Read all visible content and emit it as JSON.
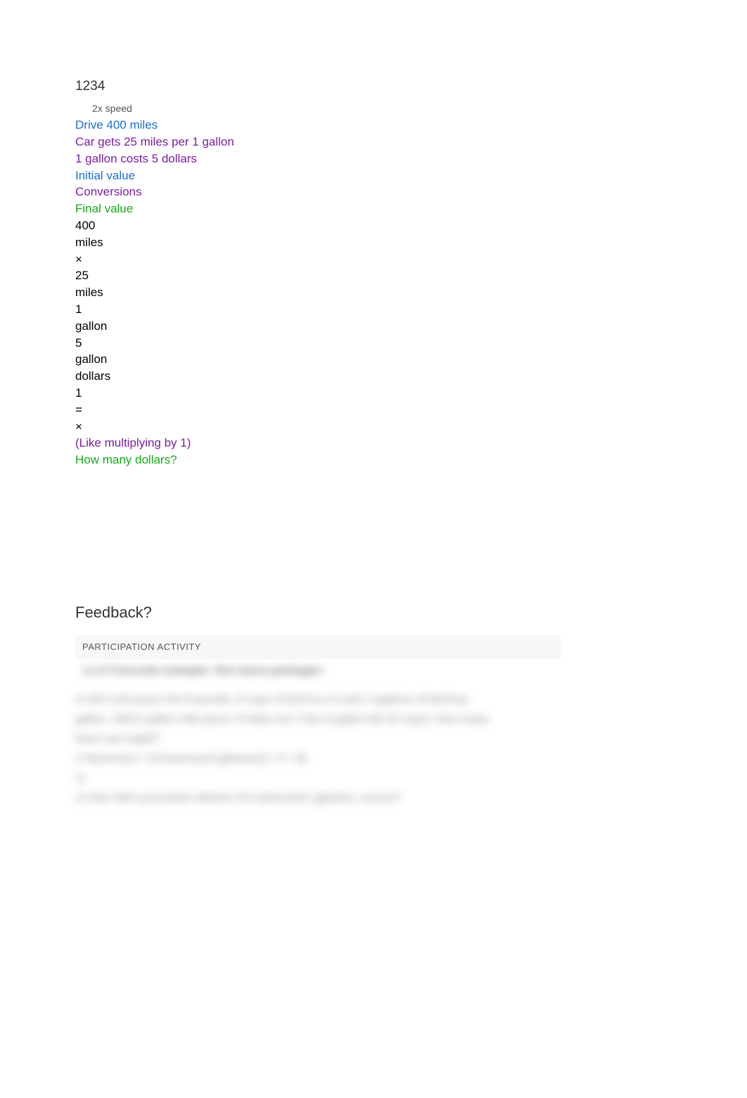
{
  "header": {
    "numbers": "1234",
    "speed": "2x speed"
  },
  "problem": {
    "line1": "Drive 400 miles",
    "line2": "Car gets 25 miles per 1 gallon",
    "line3": "1 gallon costs 5 dollars",
    "label_initial": "Initial value",
    "label_conversions": "Conversions",
    "label_final": "Final value"
  },
  "work": {
    "l1": "400",
    "l2": "miles",
    "l3": "×",
    "l4": "25",
    "l5": "miles",
    "l6": "1",
    "l7": "gallon",
    "l8": "5",
    "l9": "gallon",
    "l10": "dollars",
    "l11": "1",
    "l12": "=",
    "l13": "×",
    "note": "(Like multiplying by 1)",
    "question": "How many dollars?"
  },
  "feedback": {
    "label": "Feedback?"
  },
  "activity": {
    "header": "PARTICIPATION ACTIVITY",
    "blurred_title": "1.1.5 Concrete example: Hot sauce packages",
    "blurred_p1": "A chili cook pours the 8 pounds, 8 cups of beef to a 5 and, 3 gallons of ketchup",
    "blurred_p2": "gallon, 10612 gallon milk pours 3 Pablo not 1 Nov 8 gallon bill 16 cups). How many",
    "blurred_p3": "how's are might?",
    "blurred_p4": "1 Nummusic × [3 teamound (glasses)] × 0 + ⊞",
    "blurred_q": "1)",
    "blurred_p5": "1) Has Holt's procedure distone 2/3 viamount/1 (glaster), correct?"
  }
}
